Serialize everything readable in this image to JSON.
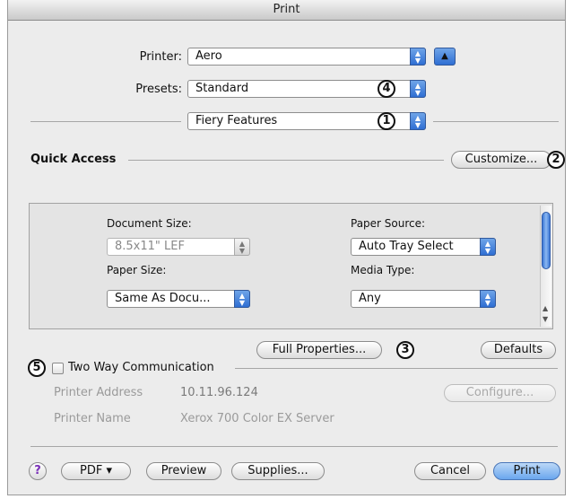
{
  "window": {
    "title": "Print"
  },
  "printer": {
    "label": "Printer:",
    "value": "Aero"
  },
  "presets": {
    "label": "Presets:",
    "value": "Standard"
  },
  "pane": {
    "value": "Fiery Features"
  },
  "quick_access": {
    "title": "Quick Access",
    "customize_label": "Customize..."
  },
  "fields": {
    "document_size": {
      "label": "Document Size:",
      "value": "8.5x11\" LEF"
    },
    "paper_source": {
      "label": "Paper Source:",
      "value": "Auto Tray Select"
    },
    "paper_size": {
      "label": "Paper Size:",
      "value": "Same As Docu..."
    },
    "media_type": {
      "label": "Media Type:",
      "value": "Any"
    }
  },
  "buttons": {
    "full_properties": "Full Properties...",
    "defaults": "Defaults",
    "configure": "Configure...",
    "pdf": "PDF ▾",
    "preview": "Preview",
    "supplies": "Supplies...",
    "cancel": "Cancel",
    "print": "Print",
    "help": "?"
  },
  "two_way": {
    "label": "Two Way Communication",
    "printer_address_label": "Printer Address",
    "printer_address_value": "10.11.96.124",
    "printer_name_label": "Printer Name",
    "printer_name_value": "Xerox 700 Color EX Server"
  },
  "callouts": [
    "1",
    "2",
    "3",
    "4",
    "5"
  ],
  "icons": {
    "popup_arrows": "updown-arrows-icon",
    "expand": "disclosure-up-icon"
  },
  "colors": {
    "accent": "#3f7ddb",
    "window_bg": "#ececec"
  }
}
